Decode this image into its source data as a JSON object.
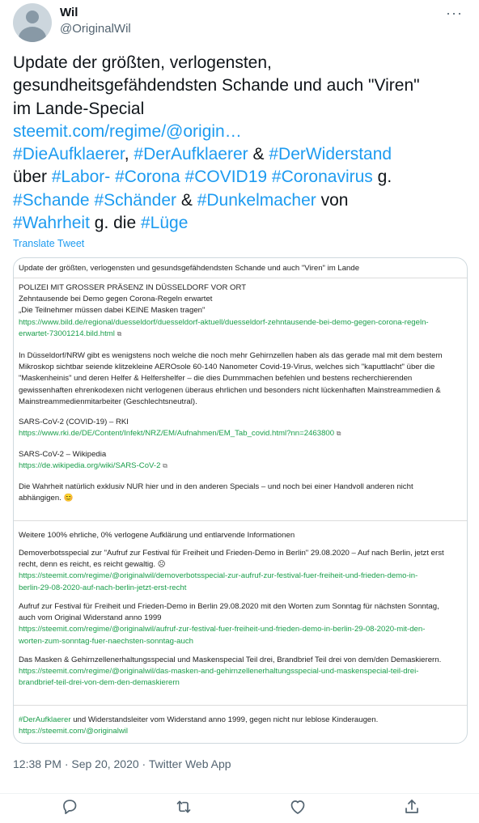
{
  "author": {
    "name": "Wil",
    "handle": "@OriginalWil"
  },
  "more_label": "···",
  "tweet": {
    "line1": "Update der größten, verlogensten,",
    "line2": "gesundheitsgefähdendsten Schande und auch \"Viren\"",
    "line3": "im Lande-Special",
    "link": "steemit.com/regime/@origin…",
    "line5": {
      "h1": "#DieAufklaerer",
      "s1": ", ",
      "h2": "#DerAufklaerer",
      "s2": " & ",
      "h3": "#DerWiderstand"
    },
    "line6": {
      "t1": "über ",
      "h1": "#Labor-",
      "s1": " ",
      "h2": "#Corona",
      "s2": " ",
      "h3": "#COVID19",
      "s3": " ",
      "h4": "#Coronavirus",
      "t2": " g."
    },
    "line7": {
      "h1": "#Schande",
      "s1": " ",
      "h2": "#Schänder",
      "s2": " & ",
      "h3": "#Dunkelmacher",
      "t1": " von"
    },
    "line8": {
      "h1": "#Wahrheit",
      "t1": " g. die ",
      "h2": "#Lüge"
    }
  },
  "translate_label": "Translate Tweet",
  "card": {
    "title": "Update der größten, verlogensten und gesundsgefähdendsten Schande und auch \"Viren\" im Lande",
    "p1": [
      "POLIZEI MIT GROSSER PRÄSENZ IN DÜSSELDORF VOR ORT",
      "Zehntausende bei Demo gegen Corona-Regeln erwartet",
      "„Die Teilnehmer müssen dabei KEINE Masken tragen\""
    ],
    "url1a": "https://www.bild.de/regional/duesseldorf/duesseldorf-aktuell/duesseldorf-zehntausende-bei-demo-gegen-corona-regeln-",
    "url1b": "erwartet-73001214.bild.html",
    "p2": [
      "In Düsseldorf/NRW gibt es wenigstens noch welche die noch mehr Gehirnzellen haben als das gerade mal mit dem bestem",
      "Mikroskop sichtbar seiende klitzekleine AEROsole 60-140 Nanometer Covid-19-Virus, welches sich \"kaputtlacht\" über die",
      "\"Maskenheinis\" und deren Helfer & Helfershelfer – die dies Dummmachen befehlen und bestens recherchierenden",
      "gewissenhaften ehrenkodexen nicht verlogenen überaus ehrlichen und besonders nicht lückenhaften Mainstreammedien &",
      "Mainstreammedienmitarbeiter (Geschlechtsneutral)."
    ],
    "rki_title": "SARS-CoV-2 (COVID-19) – RKI",
    "rki_url": "https://www.rki.de/DE/Content/Infekt/NRZ/EM/Aufnahmen/EM_Tab_covid.html?nn=2463800",
    "wiki_title": "SARS-CoV-2 – Wikipedia",
    "wiki_url": "https://de.wikipedia.org/wiki/SARS-CoV-2",
    "p3": [
      "Die Wahrheit natürlich exklusiv NUR hier und in den anderen Specials – und noch bei einer Handvoll anderen nicht",
      "abhängigen. 😊"
    ],
    "section2": "Weitere 100% ehrliche, 0% verlogene Aufklärung und entlarvende Informationen",
    "d1": [
      "Demoverbotsspecial zur \"Aufruf zur Festival für Freiheit und Frieden-Demo in Berlin\" 29.08.2020 – Auf nach Berlin, jetzt erst",
      "recht, denn es reicht, es reicht gewaltig. ☹"
    ],
    "d1url": [
      "https://steemit.com/regime/@originalwil/demoverbotsspecial-zur-aufruf-zur-festival-fuer-freiheit-und-frieden-demo-in-",
      "berlin-29-08-2020-auf-nach-berlin-jetzt-erst-recht"
    ],
    "d2": [
      "Aufruf zur Festival für Freiheit und Frieden-Demo in Berlin 29.08.2020 mit den Worten zum Sonntag für nächsten Sonntag,",
      "auch vom Original Widerstand anno 1999"
    ],
    "d2url": [
      "https://steemit.com/regime/@originalwil/aufruf-zur-festival-fuer-freiheit-und-frieden-demo-in-berlin-29-08-2020-mit-den-",
      "worten-zum-sonntag-fuer-naechsten-sonntag-auch"
    ],
    "d3": "Das Masken & Gehirnzellenerhaltungsspecial und Maskenspecial Teil drei, Brandbrief Teil drei von dem/den Demaskierern.",
    "d3url": [
      "https://steemit.com/regime/@originalwil/das-masken-and-gehirnzellenerhaltungsspecial-und-maskenspecial-teil-drei-",
      "brandbrief-teil-drei-von-dem-den-demaskierern"
    ],
    "footer_tag": "#DerAufklaerer",
    "footer_text": " und Widerstandsleiter vom Widerstand anno 1999, gegen nicht nur leblose Kinderaugen.",
    "footer_url": "https://steemit.com/@originalwil",
    "ext_icon": "⧉"
  },
  "meta": "12:38 PM · Sep 20, 2020 · Twitter Web App",
  "actions": {
    "reply_icon": "reply-icon",
    "retweet_icon": "retweet-icon",
    "like_icon": "heart-icon",
    "share_icon": "share-icon"
  }
}
